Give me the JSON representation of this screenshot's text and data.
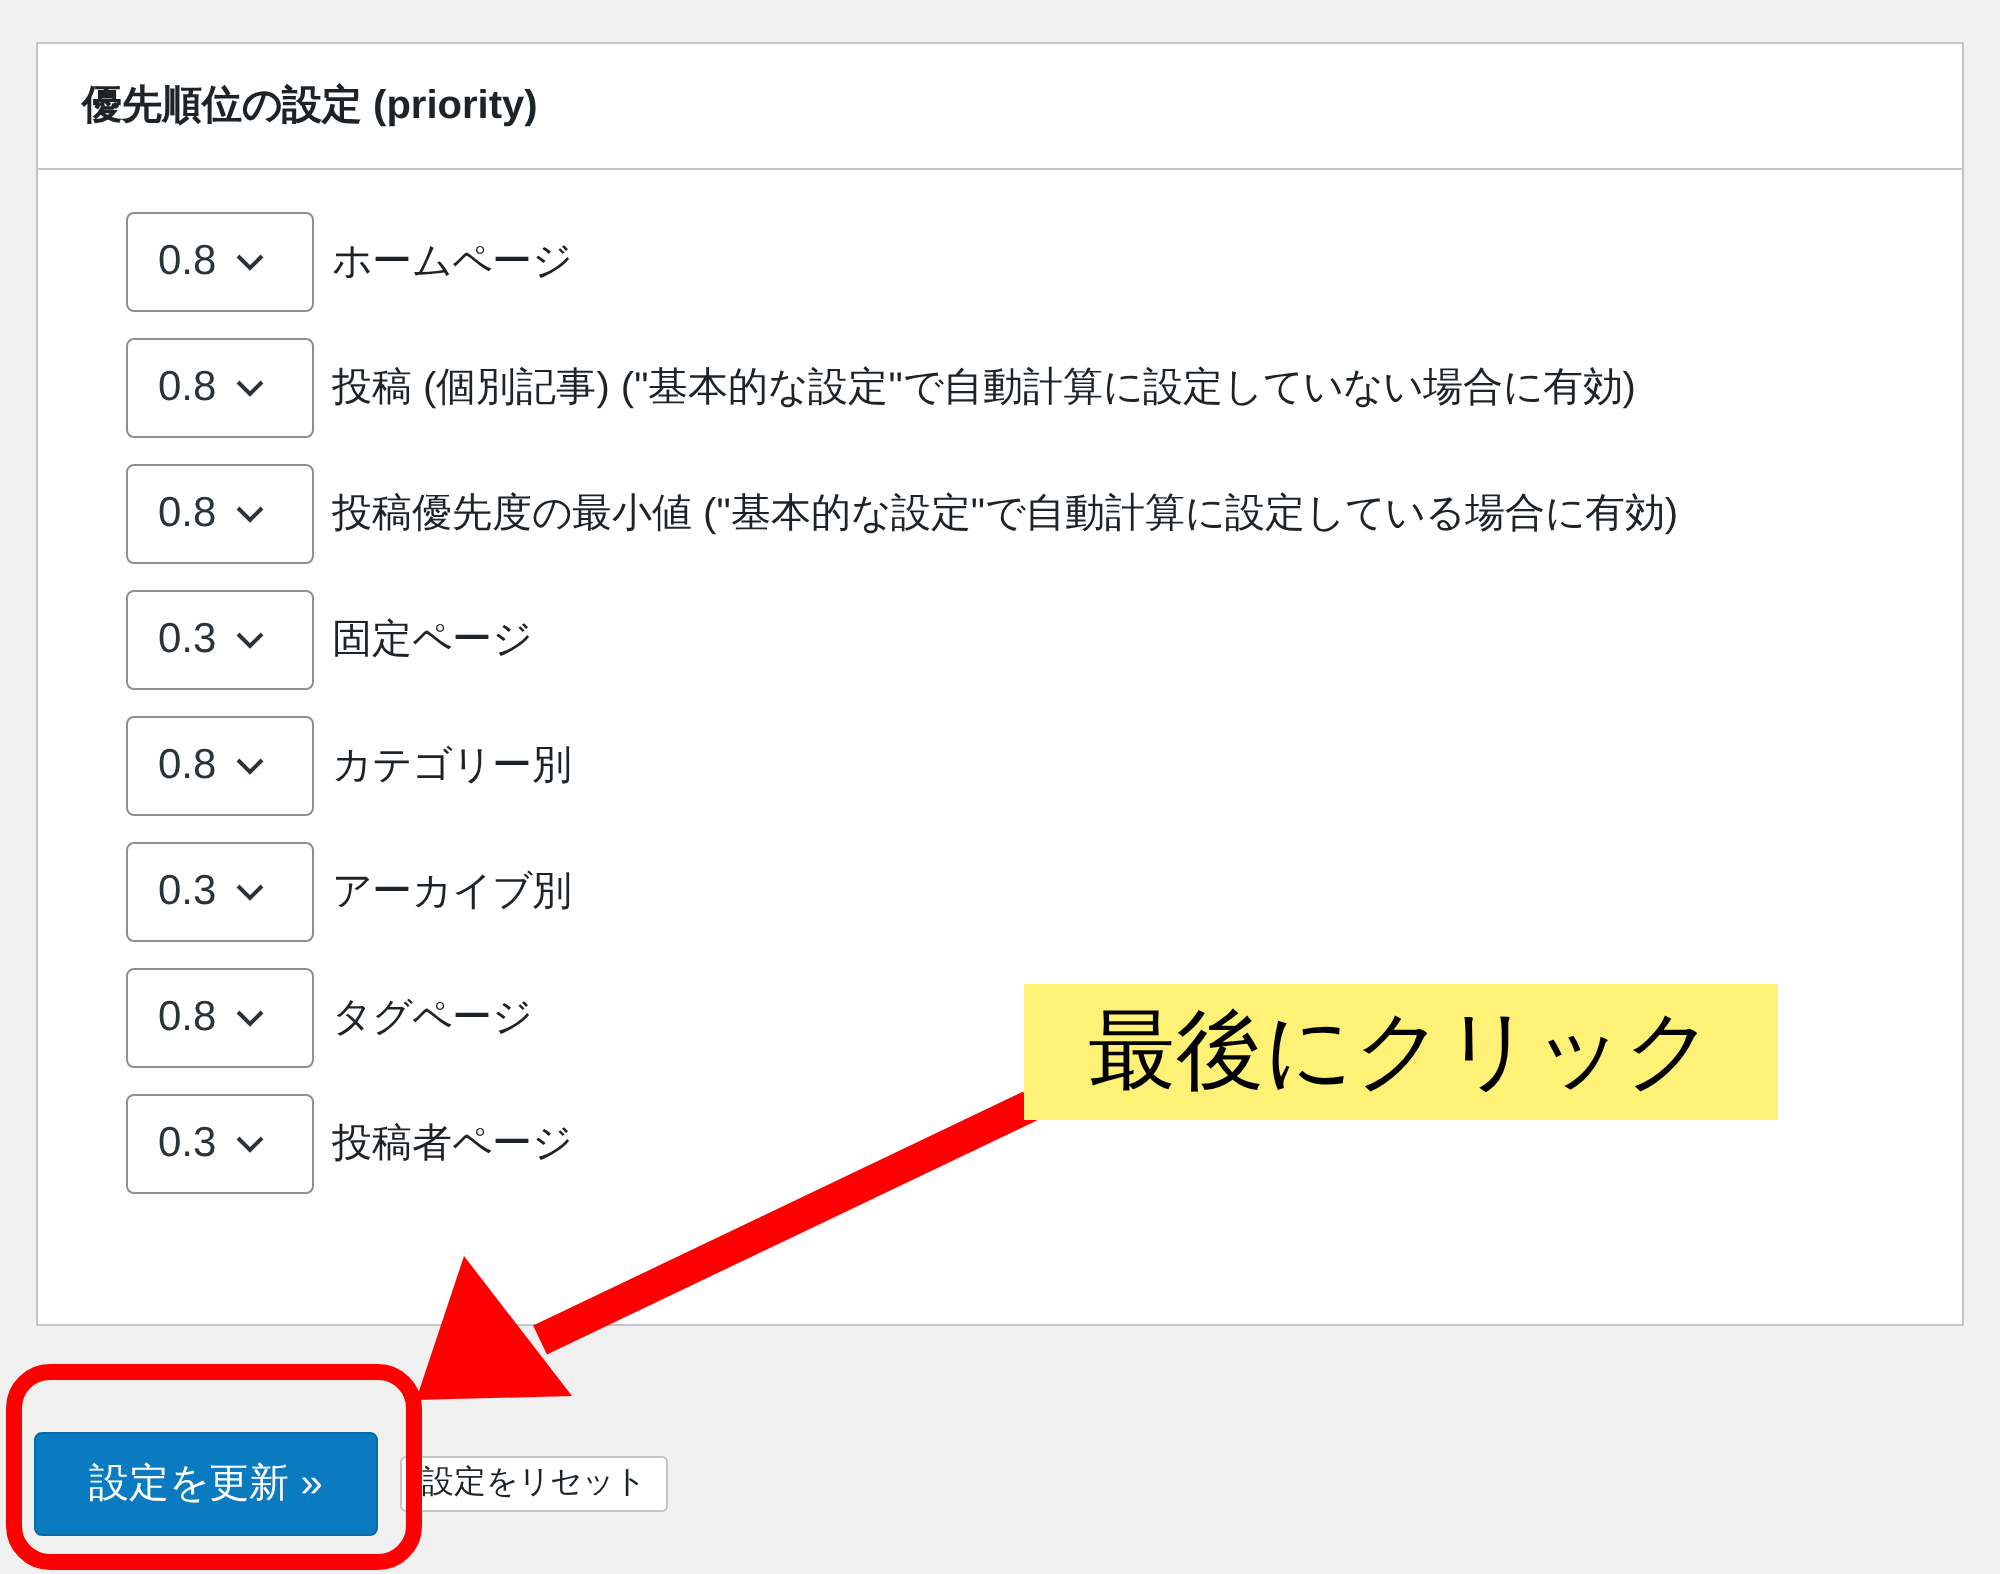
{
  "panel": {
    "title": "優先順位の設定 (priority)",
    "rows": [
      {
        "value": "0.8",
        "label": "ホームページ"
      },
      {
        "value": "0.8",
        "label": "投稿 (個別記事) (\"基本的な設定\"で自動計算に設定していない場合に有効)"
      },
      {
        "value": "0.8",
        "label": "投稿優先度の最小値 (\"基本的な設定\"で自動計算に設定している場合に有効)"
      },
      {
        "value": "0.3",
        "label": "固定ページ"
      },
      {
        "value": "0.8",
        "label": "カテゴリー別"
      },
      {
        "value": "0.3",
        "label": "アーカイブ別"
      },
      {
        "value": "0.8",
        "label": "タグページ"
      },
      {
        "value": "0.3",
        "label": "投稿者ページ"
      }
    ]
  },
  "buttons": [
    {
      "kind": "primary",
      "label": "設定を更新 »"
    },
    {
      "kind": "secondary",
      "label": "設定をリセット"
    }
  ],
  "annotation": {
    "label": "最後にクリック"
  }
}
